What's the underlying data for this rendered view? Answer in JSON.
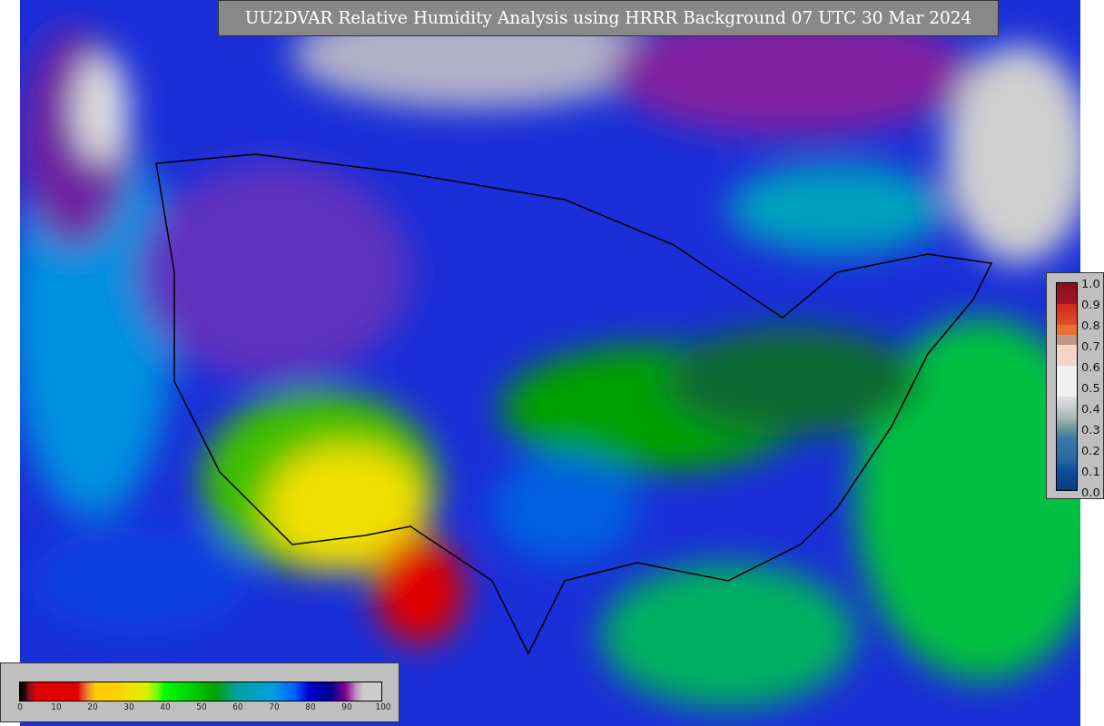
{
  "title": "UU2DVAR Relative Humidity Analysis using HRRR Background 07 UTC 30 Mar 2024",
  "ratio_colorbar": {
    "ticks": [
      "1.0",
      "0.9",
      "0.8",
      "0.7",
      "0.6",
      "0.5",
      "0.4",
      "0.3",
      "0.2",
      "0.1",
      "0.0"
    ]
  },
  "humidity_colorbar": {
    "ticks": [
      "0",
      "10",
      "20",
      "30",
      "40",
      "50",
      "60",
      "70",
      "80",
      "90",
      "100"
    ]
  }
}
